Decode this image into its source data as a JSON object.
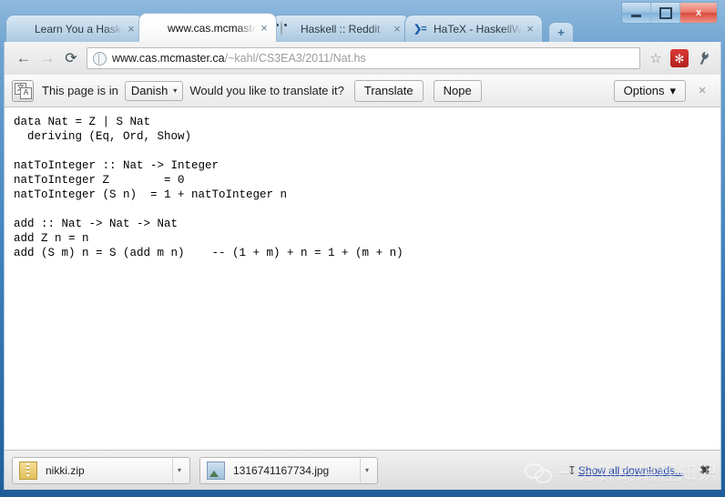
{
  "window": {
    "controls": {
      "minimize": "Minimize",
      "maximize": "Maximize",
      "close": "x"
    }
  },
  "tabs": [
    {
      "label": "Learn You a Haskell f",
      "favicon": "lyah-icon",
      "active": false,
      "close": "×"
    },
    {
      "label": "www.cas.mcmaster.c",
      "favicon": "spiral-icon",
      "active": true,
      "close": "×"
    },
    {
      "label": "Haskell :: Reddit",
      "favicon": "reddit-icon",
      "active": false,
      "close": "×"
    },
    {
      "label": "HaTeX - HaskellWiki",
      "favicon": "hatex-icon",
      "active": false,
      "close": "×"
    }
  ],
  "new_tab": {
    "label": "+"
  },
  "toolbar": {
    "back": "←",
    "forward": "→",
    "reload": "⟳",
    "url_prefix": "www.cas.mcmaster.ca",
    "url_suffix": "/~kahl/CS3EA3/2011/Nat.hs",
    "url_full": "www.cas.mcmaster.ca/~kahl/CS3EA3/2011/Nat.hs",
    "star": "☆",
    "extension_glyph": "✻",
    "extension_color": "#c0201d",
    "wrench": "ᵀ"
  },
  "infobar": {
    "icon_left_glyph": "文",
    "icon_right_glyph": "A",
    "prefix_text": "This page is in",
    "language": "Danish",
    "caret": "▾",
    "question_text": "Would you like to translate it?",
    "translate_label": "Translate",
    "nope_label": "Nope",
    "options_label": "Options",
    "options_caret": "▾",
    "close": "×"
  },
  "page": {
    "code": "data Nat = Z | S Nat\n  deriving (Eq, Ord, Show)\n\nnatToInteger :: Nat -> Integer\nnatToInteger Z        = 0\nnatToInteger (S n)  = 1 + natToInteger n\n\nadd :: Nat -> Nat -> Nat\nadd Z n = n\nadd (S m) n = S (add m n)    -- (1 + m) + n = 1 + (m + n)"
  },
  "download_shelf": {
    "items": [
      {
        "name": "nikki.zip",
        "icon": "zip-file-icon",
        "caret": "▾"
      },
      {
        "name": "1316741167734.jpg",
        "icon": "image-file-icon",
        "caret": "▾"
      }
    ],
    "download_arrow": "↧",
    "show_all_label": "Show all downloads...",
    "close": "✖"
  },
  "watermark": {
    "text": "一分钟的编程知识",
    "logo": "wechat-icon"
  }
}
